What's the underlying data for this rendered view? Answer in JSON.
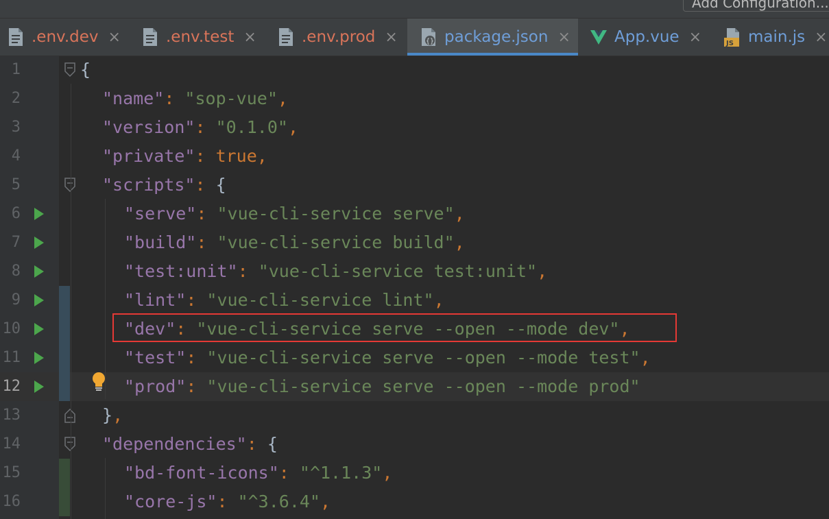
{
  "toolbar": {
    "add_configuration_label": "Add Configuration..."
  },
  "tabs": [
    {
      "label": ".env.dev",
      "icon": "text-file-icon",
      "close": "×"
    },
    {
      "label": ".env.test",
      "icon": "text-file-icon",
      "close": "×"
    },
    {
      "label": ".env.prod",
      "icon": "text-file-icon",
      "close": "×"
    },
    {
      "label": "package.json",
      "icon": "json-file-icon",
      "close": "×",
      "active": true
    },
    {
      "label": "App.vue",
      "icon": "vue-icon",
      "close": "×"
    },
    {
      "label": "main.js",
      "icon": "js-file-icon",
      "close": "×"
    }
  ],
  "editor": {
    "current_line": 12,
    "highlighted_line": 10,
    "lines": [
      {
        "n": "1",
        "tokens": [
          [
            "plain",
            "{"
          ]
        ]
      },
      {
        "n": "2",
        "tokens": [
          [
            "key",
            "\"name\""
          ],
          [
            "pun",
            ": "
          ],
          [
            "str",
            "\"sop-vue\""
          ],
          [
            "pun",
            ","
          ]
        ]
      },
      {
        "n": "3",
        "tokens": [
          [
            "key",
            "\"version\""
          ],
          [
            "pun",
            ": "
          ],
          [
            "str",
            "\"0.1.0\""
          ],
          [
            "pun",
            ","
          ]
        ]
      },
      {
        "n": "4",
        "tokens": [
          [
            "key",
            "\"private\""
          ],
          [
            "pun",
            ": "
          ],
          [
            "kw",
            "true"
          ],
          [
            "pun",
            ","
          ]
        ]
      },
      {
        "n": "5",
        "tokens": [
          [
            "key",
            "\"scripts\""
          ],
          [
            "pun",
            ": "
          ],
          [
            "plain",
            "{"
          ]
        ]
      },
      {
        "n": "6",
        "tokens": [
          [
            "key",
            "\"serve\""
          ],
          [
            "pun",
            ": "
          ],
          [
            "str",
            "\"vue-cli-service serve\""
          ],
          [
            "pun",
            ","
          ]
        ]
      },
      {
        "n": "7",
        "tokens": [
          [
            "key",
            "\"build\""
          ],
          [
            "pun",
            ": "
          ],
          [
            "str",
            "\"vue-cli-service build\""
          ],
          [
            "pun",
            ","
          ]
        ]
      },
      {
        "n": "8",
        "tokens": [
          [
            "key",
            "\"test:unit\""
          ],
          [
            "pun",
            ": "
          ],
          [
            "str",
            "\"vue-cli-service test:unit\""
          ],
          [
            "pun",
            ","
          ]
        ]
      },
      {
        "n": "9",
        "tokens": [
          [
            "key",
            "\"lint\""
          ],
          [
            "pun",
            ": "
          ],
          [
            "str",
            "\"vue-cli-service lint\""
          ],
          [
            "pun",
            ","
          ]
        ]
      },
      {
        "n": "10",
        "tokens": [
          [
            "key",
            "\"dev\""
          ],
          [
            "pun",
            ": "
          ],
          [
            "str",
            "\"vue-cli-service serve --open --mode dev\""
          ],
          [
            "pun",
            ","
          ]
        ]
      },
      {
        "n": "11",
        "tokens": [
          [
            "key",
            "\"test\""
          ],
          [
            "pun",
            ": "
          ],
          [
            "str",
            "\"vue-cli-service serve --open --mode test\""
          ],
          [
            "pun",
            ","
          ]
        ]
      },
      {
        "n": "12",
        "tokens": [
          [
            "key",
            "\"prod\""
          ],
          [
            "pun",
            ": "
          ],
          [
            "str",
            "\"vue-cli-service serve --open --mode prod\""
          ]
        ]
      },
      {
        "n": "13",
        "tokens": [
          [
            "plain",
            "}"
          ],
          [
            "pun",
            ","
          ]
        ]
      },
      {
        "n": "14",
        "tokens": [
          [
            "key",
            "\"dependencies\""
          ],
          [
            "pun",
            ": "
          ],
          [
            "plain",
            "{"
          ]
        ]
      },
      {
        "n": "15",
        "tokens": [
          [
            "key",
            "\"bd-font-icons\""
          ],
          [
            "pun",
            ": "
          ],
          [
            "str",
            "\"^1.1.3\""
          ],
          [
            "pun",
            ","
          ]
        ]
      },
      {
        "n": "16",
        "tokens": [
          [
            "key",
            "\"core-js\""
          ],
          [
            "pun",
            ": "
          ],
          [
            "str",
            "\"^3.6.4\""
          ],
          [
            "pun",
            ","
          ]
        ]
      }
    ]
  },
  "colors": {
    "accent": "#4a88c7",
    "highlight_border": "#e53935",
    "run_green": "#4ca64c",
    "env_tab_text": "#d9745a",
    "active_tab_text": "#6f9ed8"
  }
}
